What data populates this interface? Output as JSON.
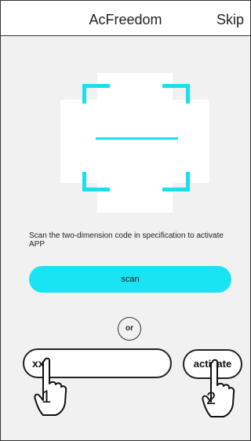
{
  "header": {
    "title": "AcFreedom",
    "skip_label": "Skip"
  },
  "scanner": {
    "accent_color": "#19e0f0"
  },
  "instruction_text": "Scan the two-dimension code in specification to activate APP",
  "scan_button_label": "scan",
  "divider_label": "or",
  "activation": {
    "code_value": "xxx",
    "activate_label": "activate"
  },
  "tutorial": {
    "step1": "1",
    "step2": "2"
  }
}
